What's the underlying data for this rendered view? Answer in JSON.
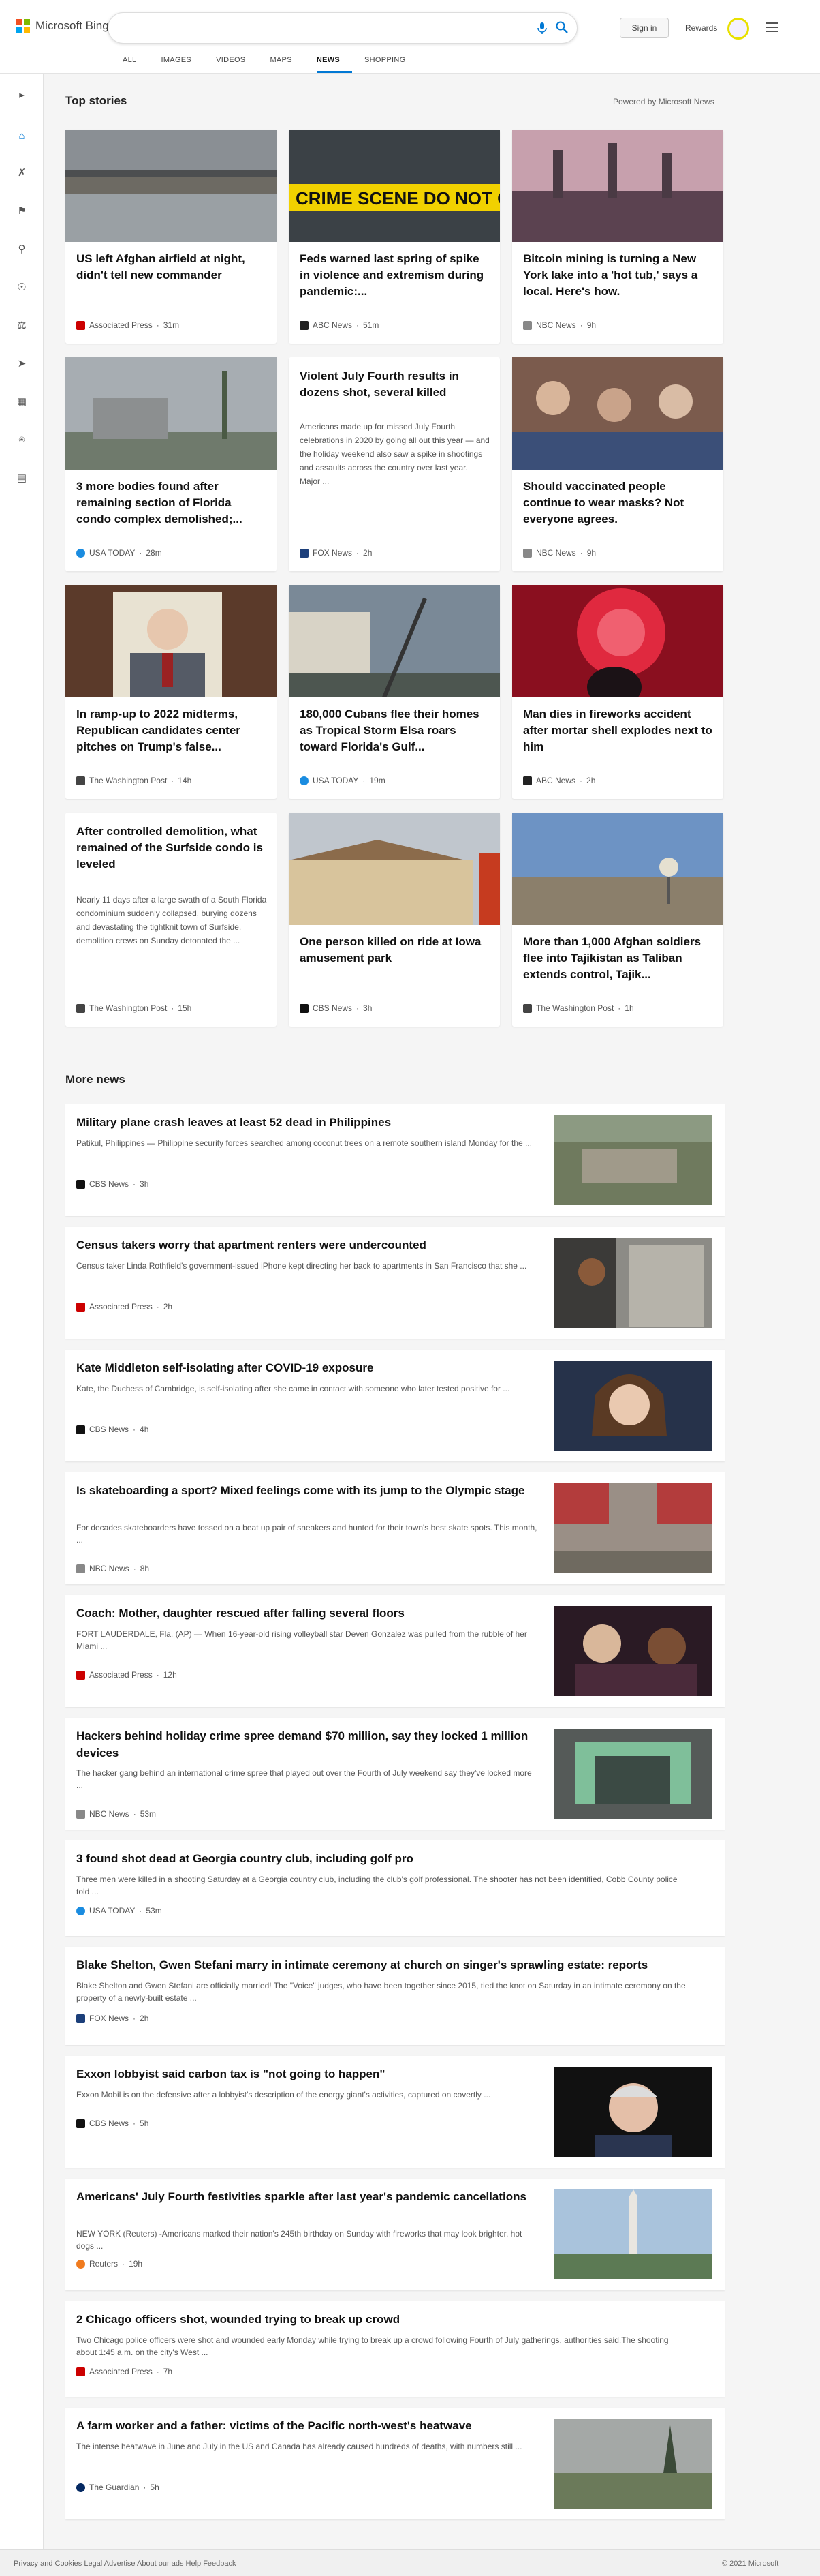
{
  "header": {
    "brand": "Microsoft Bing",
    "signin_label": "Sign in",
    "rewards_label": "Rewards",
    "tabs": [
      "ALL",
      "IMAGES",
      "VIDEOS",
      "MAPS",
      "NEWS",
      "SHOPPING"
    ],
    "active_tab": "NEWS"
  },
  "top_stories": {
    "heading": "Top stories",
    "powered_by": "Powered by Microsoft News",
    "cards": [
      {
        "title": "US left Afghan airfield at night, didn't tell new commander",
        "source": "Associated Press",
        "time": "31m"
      },
      {
        "title": "Feds warned last spring of spike in violence and extremism during pandemic:...",
        "source": "ABC News",
        "time": "51m"
      },
      {
        "title": "Bitcoin mining is turning a New York lake into a 'hot tub,' says a local. Here's how.",
        "source": "NBC News",
        "time": "9h"
      },
      {
        "title": "3 more bodies found after remaining section of Florida condo complex demolished;...",
        "source": "USA TODAY",
        "time": "28m"
      },
      {
        "title": "Violent July Fourth results in dozens shot, several killed",
        "snippet": "Americans made up for missed July Fourth celebrations in 2020 by going all out this year — and the holiday weekend also saw a spike in shootings and assaults across the country over last year.  Major ...",
        "source": "FOX News",
        "time": "2h"
      },
      {
        "title": "Should vaccinated people continue to wear masks? Not everyone agrees.",
        "source": "NBC News",
        "time": "9h"
      },
      {
        "title": "In ramp-up to 2022 midterms, Republican candidates center pitches on Trump's false...",
        "source": "The Washington Post",
        "time": "14h"
      },
      {
        "title": "180,000 Cubans flee their homes as Tropical Storm Elsa roars toward Florida's Gulf...",
        "source": "USA TODAY",
        "time": "19m"
      },
      {
        "title": "Man dies in fireworks accident after mortar shell explodes next to him",
        "source": "ABC News",
        "time": "2h"
      },
      {
        "title": "After controlled demolition, what remained of the Surfside condo is leveled",
        "snippet": "Nearly 11 days after a large swath of a South Florida condominium suddenly collapsed, burying dozens and devastating the tightknit town of Surfside, demolition crews on Sunday detonated the ...",
        "source": "The Washington Post",
        "time": "15h"
      },
      {
        "title": "One person killed on ride at Iowa amusement park",
        "source": "CBS News",
        "time": "3h"
      },
      {
        "title": "More than 1,000 Afghan soldiers flee into Tajikistan as Taliban extends control, Tajik...",
        "source": "The Washington Post",
        "time": "1h"
      }
    ]
  },
  "more_news": {
    "heading": "More news",
    "items": [
      {
        "title": "Military plane crash leaves at least 52 dead in Philippines",
        "snippet": "Patikul, Philippines — Philippine security forces searched among coconut trees on a remote southern island Monday for the ...",
        "source": "CBS News",
        "time": "3h"
      },
      {
        "title": "Census takers worry that apartment renters were undercounted",
        "snippet": "Census taker Linda Rothfield's government-issued iPhone kept directing her back to apartments in San Francisco that she ...",
        "source": "Associated Press",
        "time": "2h"
      },
      {
        "title": "Kate Middleton self-isolating after COVID-19 exposure",
        "snippet": "Kate, the Duchess of Cambridge, is self-isolating after she came in contact with someone who later tested positive for ...",
        "source": "CBS News",
        "time": "4h"
      },
      {
        "title": "Is skateboarding a sport? Mixed feelings come with its jump to the Olympic stage",
        "snippet": "For decades skateboarders have tossed on a beat up pair of sneakers and hunted for their town's best skate spots. This month, ...",
        "source": "NBC News",
        "time": "8h"
      },
      {
        "title": "Coach: Mother, daughter rescued after falling several floors",
        "snippet": "FORT LAUDERDALE, Fla. (AP) — When 16-year-old rising volleyball star Deven Gonzalez was pulled from the rubble of her Miami ...",
        "source": "Associated Press",
        "time": "12h"
      },
      {
        "title": "Hackers behind holiday crime spree demand $70 million, say they locked 1 million devices",
        "snippet": "The hacker gang behind an international crime spree that played out over the Fourth of July weekend say they've locked more ...",
        "source": "NBC News",
        "time": "53m"
      },
      {
        "title": "3 found shot dead at Georgia country club, including golf pro",
        "snippet": "Three men were killed in a shooting Saturday at a Georgia country club, including the club's golf professional. The shooter has not been identified, Cobb County police told ...",
        "source": "USA TODAY",
        "time": "53m"
      },
      {
        "title": "Blake Shelton, Gwen Stefani marry in intimate ceremony at church on singer's sprawling estate: reports",
        "snippet": "Blake Shelton and Gwen Stefani are officially married! The \"Voice\" judges, who have been together since 2015, tied the knot on Saturday in an intimate ceremony on the property of a newly-built estate ...",
        "source": "FOX News",
        "time": "2h"
      },
      {
        "title": "Exxon lobbyist said carbon tax is \"not going to happen\"",
        "snippet": "Exxon Mobil is on the defensive after a lobbyist's description of the energy giant's activities, captured on covertly ...",
        "source": "CBS News",
        "time": "5h"
      },
      {
        "title": "Americans' July Fourth festivities sparkle after last year's pandemic cancellations",
        "snippet": "NEW YORK (Reuters) -Americans marked their nation's 245th birthday on Sunday with fireworks that may look brighter, hot dogs ...",
        "source": "Reuters",
        "time": "19h"
      },
      {
        "title": "2 Chicago officers shot, wounded trying to break up crowd",
        "snippet": "Two Chicago police officers were shot and wounded early Monday while trying to break up a crowd following Fourth of July gatherings, authorities said.The shooting about 1:45 a.m. on the city's West ...",
        "source": "Associated Press",
        "time": "7h"
      },
      {
        "title": "A farm worker and a father: victims of the Pacific north-west's heatwave",
        "snippet": "The intense heatwave in June and July in the US and Canada has already caused hundreds of deaths, with numbers still ...",
        "source": "The Guardian",
        "time": "5h"
      }
    ]
  },
  "footer": {
    "left": "Privacy and Cookies   Legal   Advertise   About our ads   Help   Feedback",
    "right": "© 2021 Microsoft"
  }
}
